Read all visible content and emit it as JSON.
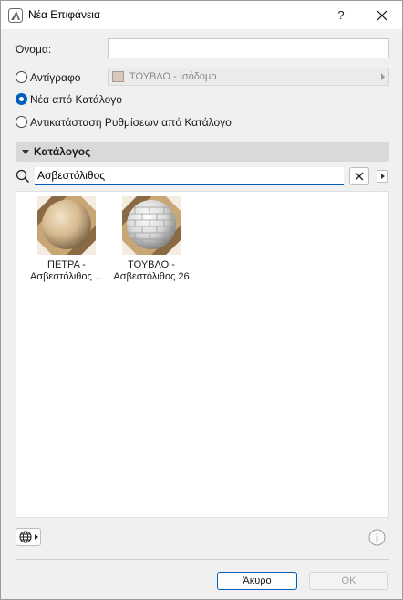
{
  "window": {
    "title": "Νέα Επιφάνεια",
    "help_label": "?"
  },
  "form": {
    "name_label": "Όνομα:",
    "name_value": "",
    "copy_label": "Αντίγραφο",
    "copy_source": "ΤΟΥΒΛΟ - Ισόδομο",
    "new_from_catalog_label": "Νέα από Κατάλογο",
    "replace_settings_label": "Αντικατάσταση Ρυθμίσεων από Κατάλογο",
    "selected_option": "new_from_catalog"
  },
  "catalog": {
    "section_label": "Κατάλογος",
    "search_value": "Ασβεστόλιθος",
    "results": [
      {
        "line1": "ΠΕΤΡΑ -",
        "line2": "Ασβεστόλιθος ...",
        "icon": "sandstone-sphere"
      },
      {
        "line1": "ΤΟΥΒΛΟ -",
        "line2": "Ασβεστόλιθος 26",
        "icon": "brick-sphere"
      }
    ]
  },
  "buttons": {
    "cancel": "Άκυρο",
    "ok": "OK"
  },
  "colors": {
    "accent": "#005fb8",
    "swatch": "#d9c6bd"
  }
}
